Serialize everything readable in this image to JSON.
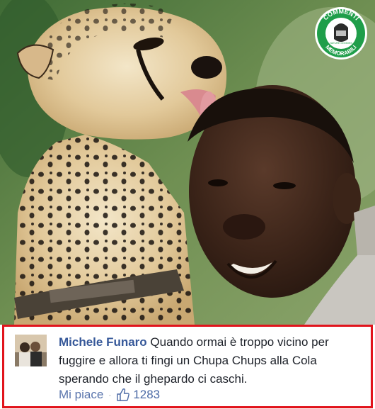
{
  "badge": {
    "top_text": "COMMENTI",
    "bottom_text": "MEMORABILI",
    "small_text": "NATURE GOODIES",
    "color": "#1f9e4a"
  },
  "comment": {
    "author": "Michele Funaro",
    "text": "Quando ormai è troppo vicino per fuggire e allora ti fingi un Chupa Chups alla Cola sperando che il ghepardo ci caschi.",
    "like_label": "Mi piace",
    "separator": "·",
    "like_count": "1283",
    "like_icon": "thumbs-up-icon",
    "author_color": "#365899",
    "border_color": "#e1141c"
  }
}
